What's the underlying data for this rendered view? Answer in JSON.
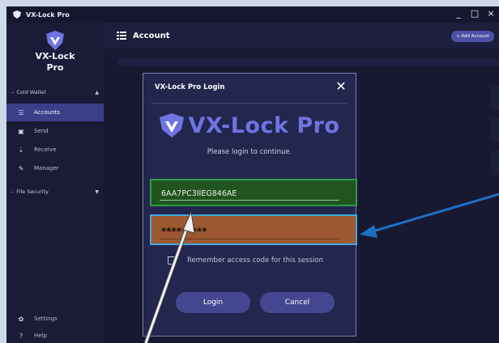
{
  "window": {
    "title": "VX-Lock Pro",
    "min": "_",
    "max": "□",
    "close": "×"
  },
  "sidebar": {
    "logo_text_1": "VX-Lock",
    "logo_text_2": "Pro",
    "section_cold": "Cold Wallet",
    "section_cold_caret": "▲",
    "items": [
      {
        "label": "Accounts",
        "icon": "list-icon"
      },
      {
        "label": "Send",
        "icon": "send-icon"
      },
      {
        "label": "Receive",
        "icon": "receive-icon"
      },
      {
        "label": "Manager",
        "icon": "pen-icon"
      }
    ],
    "section_file": "File Security",
    "section_file_caret": "▼",
    "settings": "Settings",
    "help": "Help"
  },
  "header": {
    "title": "Account",
    "add_button": "+ Add Account"
  },
  "dialog": {
    "title": "VX-Lock Pro Login",
    "brand": "VX-Lock Pro",
    "subtitle": "Please login to continue.",
    "username_value": "6AA7PC3IIEG846AE",
    "password_value": "*********",
    "remember_label": "Remember access code for this session",
    "login_label": "Login",
    "cancel_label": "Cancel"
  },
  "colors": {
    "accent": "#6f74e2",
    "username_highlight": "#21541f",
    "password_highlight": "#9b5831",
    "focus_border": "#46a7e1",
    "annotation_arrow_blue": "#1e6fc2"
  }
}
